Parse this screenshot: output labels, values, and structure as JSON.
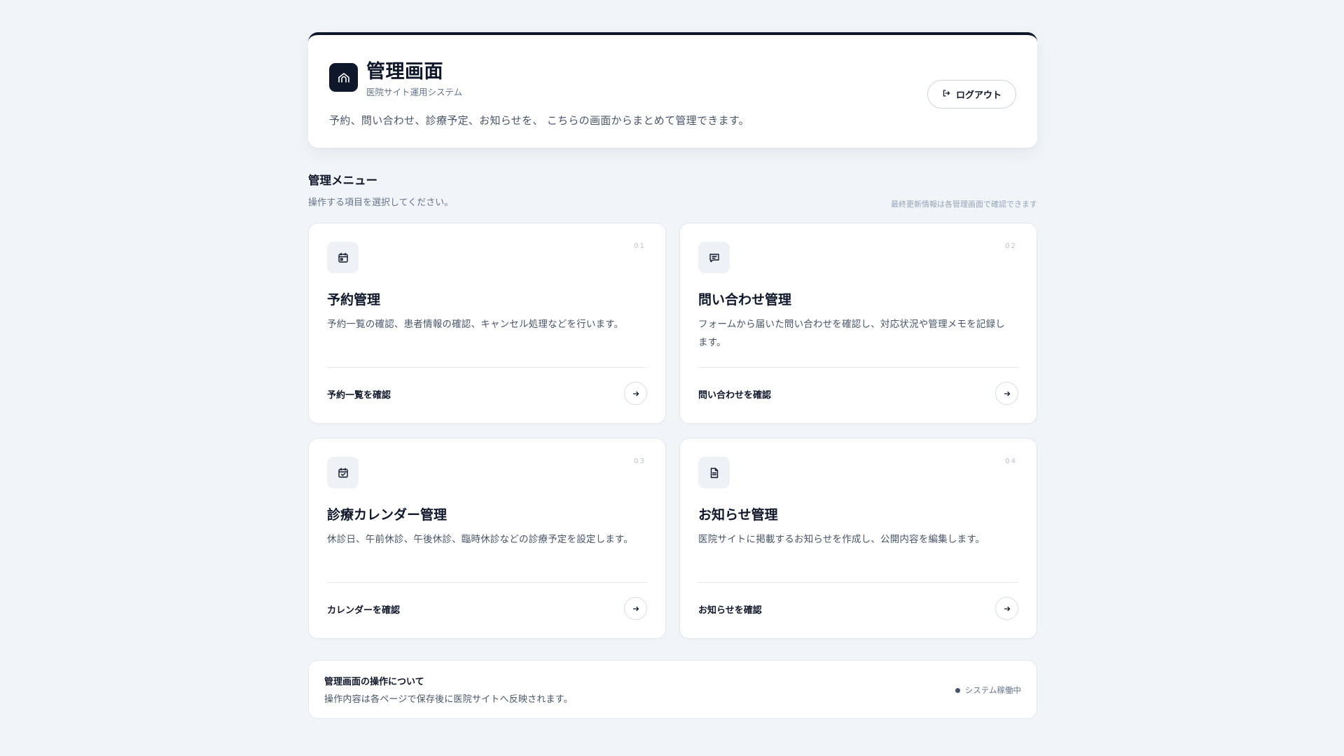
{
  "header": {
    "title": "管理画面",
    "subtitle": "医院サイト運用システム",
    "description": "予約、問い合わせ、診療予定、お知らせを、 こちらの画面からまとめて管理できます。",
    "logout_label": "ログアウト",
    "logo_icon": "house-icon",
    "logout_icon": "logout-icon"
  },
  "section": {
    "title": "管理メニュー",
    "subtitle": "操作する項目を選択してください。",
    "note": "最終更新情報は各管理画面で確認できます"
  },
  "cards": [
    {
      "number": "01",
      "icon": "calendar-icon",
      "title": "予約管理",
      "description": "予約一覧の確認、患者情報の確認、キャンセル処理などを行います。",
      "link_label": "予約一覧を確認"
    },
    {
      "number": "02",
      "icon": "message-icon",
      "title": "問い合わせ管理",
      "description": "フォームから届いた問い合わせを確認し、対応状況や管理メモを記録します。",
      "link_label": "問い合わせを確認"
    },
    {
      "number": "03",
      "icon": "calendar-check-icon",
      "title": "診療カレンダー管理",
      "description": "休診日、午前休診、午後休診、臨時休診などの診療予定を設定します。",
      "link_label": "カレンダーを確認"
    },
    {
      "number": "04",
      "icon": "document-icon",
      "title": "お知らせ管理",
      "description": "医院サイトに掲載するお知らせを作成し、公開内容を編集します。",
      "link_label": "お知らせを確認"
    }
  ],
  "footer": {
    "title": "管理画面の操作について",
    "description": "操作内容は各ページで保存後に医院サイトへ反映されます。",
    "status": "システム稼働中"
  },
  "colors": {
    "primary": "#0f172a",
    "background": "#f2f5f8",
    "muted_text": "#64748b",
    "icon_bg": "#eef2f6"
  }
}
